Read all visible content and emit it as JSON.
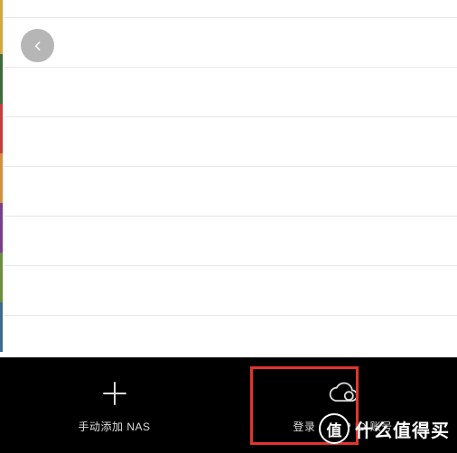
{
  "edge_colors": [
    "#d4a83e",
    "#3d6b3a",
    "#c73e3a",
    "#d48f3e",
    "#7a3e8f",
    "#6b8f3e",
    "#3e6b8f"
  ],
  "list": {
    "rows": 7
  },
  "bottom": {
    "add_label": "手动添加 NAS",
    "login_label": "登录 QNAP ID 账号"
  },
  "watermark": {
    "badge": "值",
    "text": "什么值得买"
  }
}
